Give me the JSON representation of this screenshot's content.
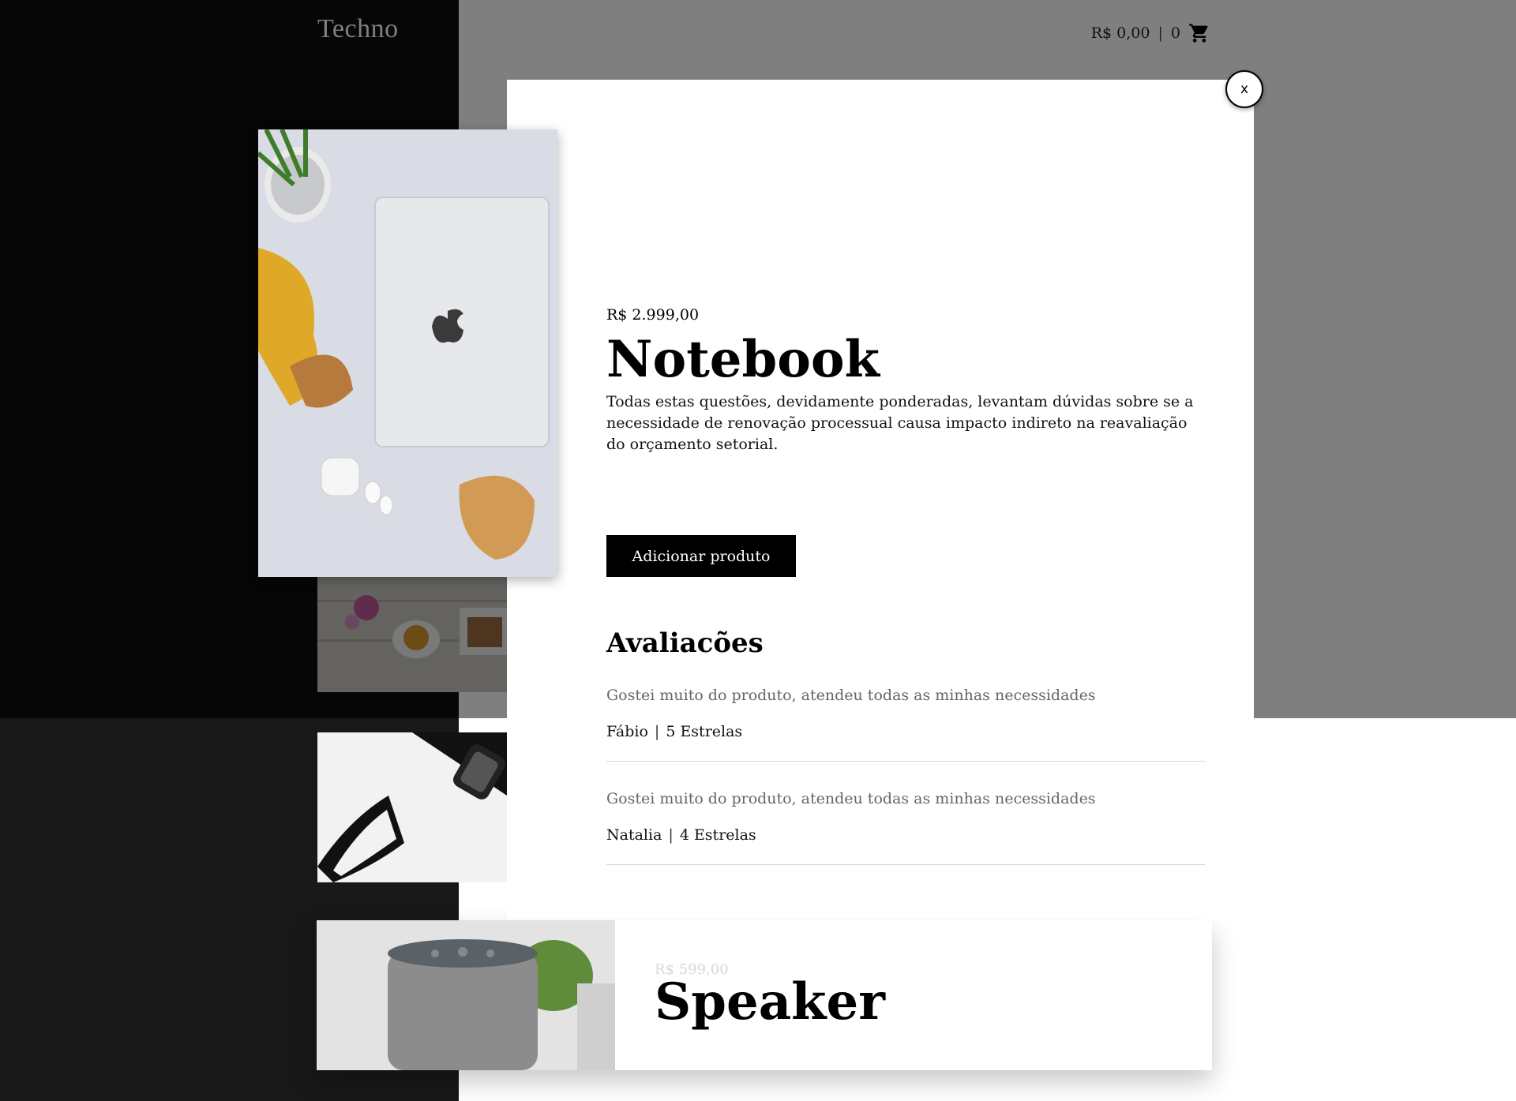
{
  "header": {
    "logo": "Techno",
    "cart_total": "R$ 0,00",
    "cart_separator": "|",
    "cart_count": "0",
    "cart_icon": "shopping-cart-icon"
  },
  "list": {
    "speaker": {
      "price": "R$ 599,00",
      "name": "Speaker"
    }
  },
  "modal": {
    "close_label": "x",
    "price": "R$ 2.999,00",
    "title": "Notebook",
    "description": "Todas estas questões, devidamente ponderadas, levantam dúvidas sobre se a necessidade de renovação processual causa impacto indireto na reavaliação do orçamento setorial.",
    "add_button": "Adicionar produto",
    "reviews_title": "Avaliacões",
    "reviews": [
      {
        "text": "Gostei muito do produto, atendeu todas as minhas necessidades",
        "author": "Fábio",
        "rating": "5 Estrelas"
      },
      {
        "text": "Gostei muito do produto, atendeu todas as minhas necessidades",
        "author": "Natalia",
        "rating": "4 Estrelas"
      }
    ],
    "review_separator": "|"
  },
  "colors": {
    "dark_panel": "#0c0c0c",
    "dark_panel_lower": "#181818",
    "overlay": "rgba(0,0,0,0.5)",
    "button": "#000000"
  }
}
